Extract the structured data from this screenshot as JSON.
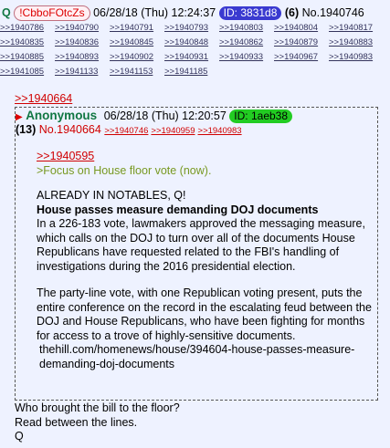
{
  "post": {
    "name": "Q",
    "tripcode": "!CbboFOtcZs",
    "datetime": "06/28/18 (Thu) 12:24:37",
    "id_label": "ID: 3831d8",
    "id_color": "#3a3ad0",
    "reply_count": "(6)",
    "post_number": "No.1940746",
    "backlinks": [
      [
        ">>1940786",
        ">>1940790",
        ">>1940791",
        ">>1940793",
        ">>1940803",
        ">>1940804",
        ">>1940817"
      ],
      [
        ">>1940835",
        ">>1940836",
        ">>1940845",
        ">>1940848",
        ">>1940862",
        ">>1940879",
        ">>1940883"
      ],
      [
        ">>1940885",
        ">>1940893",
        ">>1940902",
        ">>1940931",
        ">>1940933",
        ">>1940967",
        ">>1940983"
      ],
      [
        ">>1941085",
        ">>1941133",
        ">>1941153",
        ">>1941185"
      ]
    ],
    "reference_link": ">>1940664",
    "message": [
      "Who brought the bill to the floor?",
      "Read between the lines.",
      "Q"
    ]
  },
  "quoted": {
    "name": "Anonymous",
    "datetime": "06/28/18 (Thu) 12:20:57",
    "id_label": "ID: 1aeb38",
    "id_color": "#22cc22",
    "reply_count": "(13)",
    "post_number": "No.1940664",
    "backlinks": [
      ">>1940746",
      ">>1940959",
      ">>1940983"
    ],
    "body": {
      "link": ">>1940595",
      "greentext": ">Focus on House floor vote (now).",
      "notables": "ALREADY IN NOTABLES, Q!",
      "headline": "House passes measure demanding DOJ documents",
      "para1": "In a 226-183 vote, lawmakers approved the messaging measure, which calls on the DOJ to turn over all of the documents House Republicans have requested related to the FBI's handling of investigations during the 2016 presidential election.",
      "para2": "The party-line vote, with one Republican voting present, puts the entire conference on the record in the escalating feud between the DOJ and House Republicans, who have been fighting for months for access to a trove of highly-sensitive documents.",
      "url": "thehill.com/homenews/house/394604-house-passes-measure-demanding-doj-documents"
    }
  },
  "colors": {
    "background": "#eef2ff",
    "name_green": "#117743",
    "link_red": "#d00000",
    "greentext": "#789922"
  }
}
